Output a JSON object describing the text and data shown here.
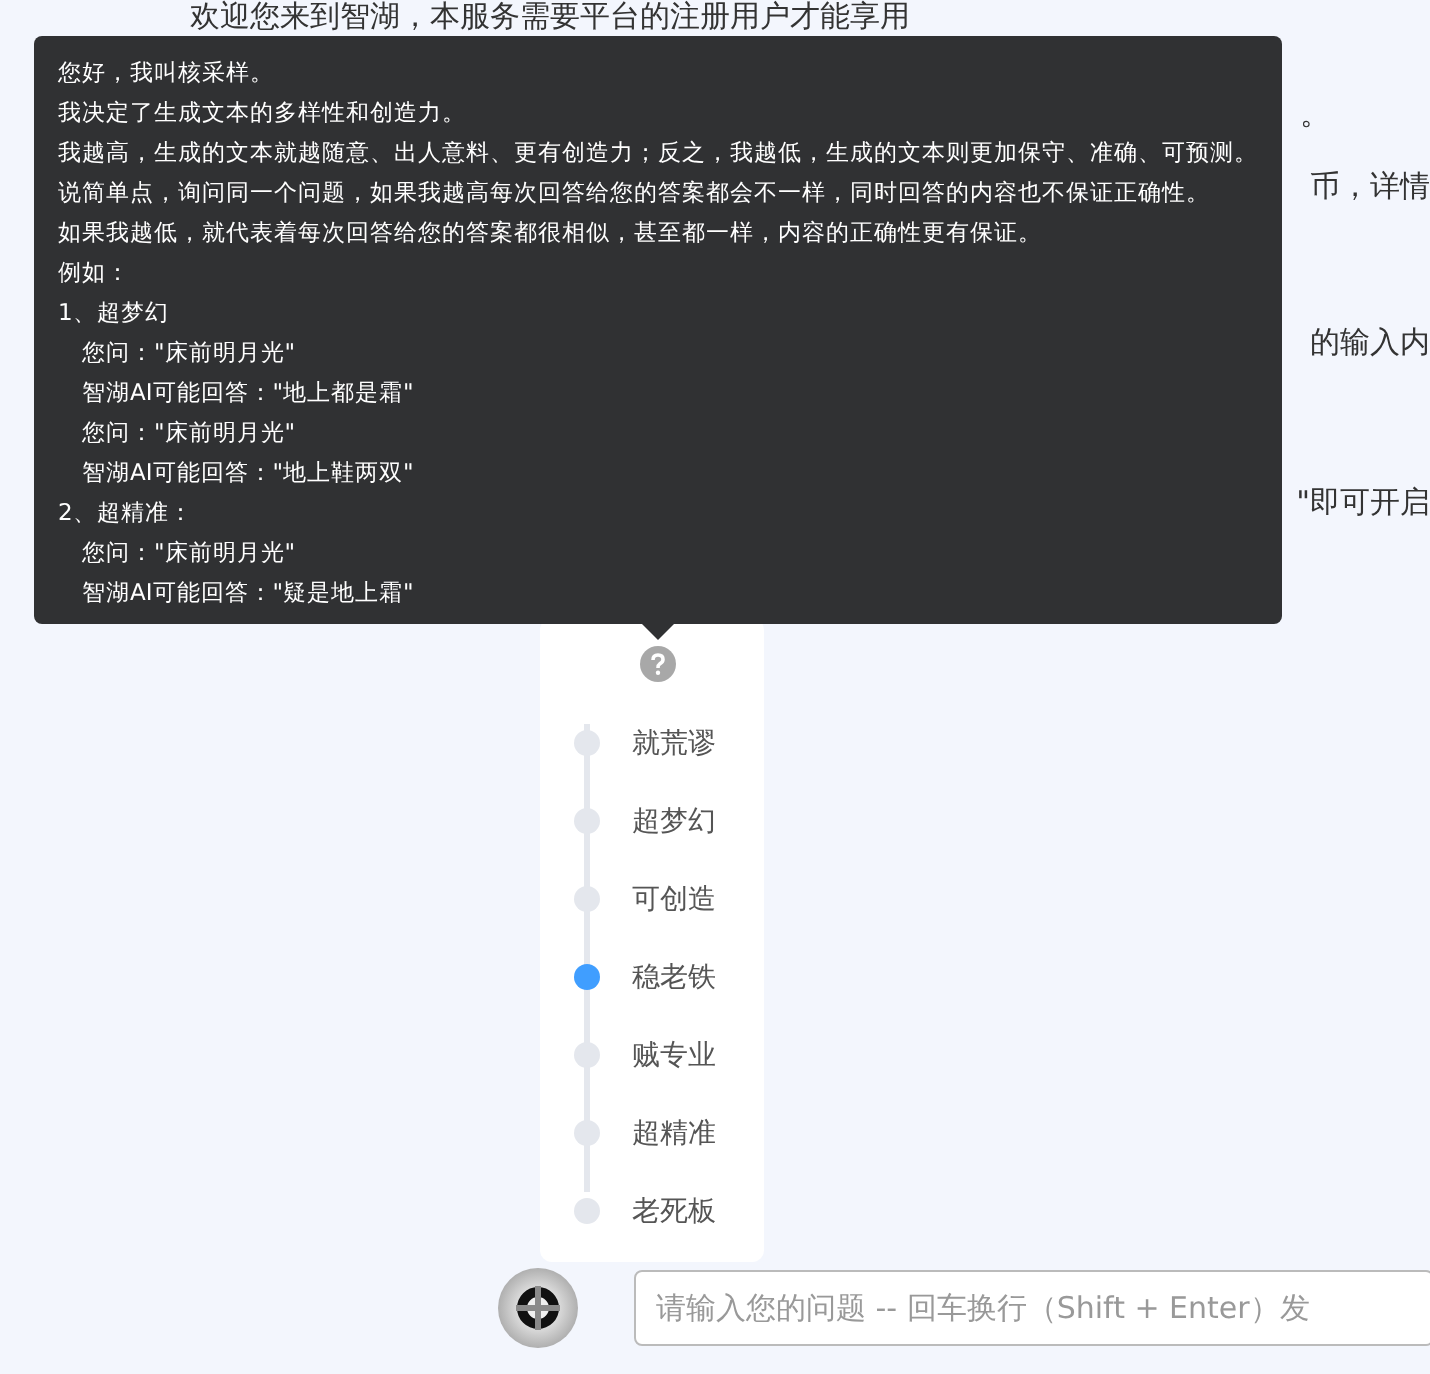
{
  "background_text": {
    "first_line": "欢迎您来到智湖，本服务需要平台的注册用户才能享用",
    "fragments": [
      "。",
      "币，详情",
      "的输入内",
      "\"即可开启"
    ]
  },
  "tooltip": {
    "paragraphs": [
      "您好，我叫核采样。",
      "我决定了生成文本的多样性和创造力。",
      "我越高，生成的文本就越随意、出人意料、更有创造力；反之，我越低，生成的文本则更加保守、准确、可预测。",
      "说简单点，询问同一个问题，如果我越高每次回答给您的答案都会不一样，同时回答的内容也不保证正确性。",
      "如果我越低，就代表着每次回答给您的答案都很相似，甚至都一样，内容的正确性更有保证。",
      "例如："
    ],
    "examples": [
      {
        "title": "1、超梦幻",
        "children": [
          "您问：\"床前明月光\"",
          "智湖AI可能回答：\"地上都是霜\"",
          "您问：\"床前明月光\"",
          "智湖AI可能回答：\"地上鞋两双\""
        ]
      },
      {
        "title": "2、超精准：",
        "children": [
          "您问：\"床前明月光\"",
          "智湖AI可能回答：\"疑是地上霜\""
        ]
      }
    ]
  },
  "slider": {
    "items": [
      {
        "label": "就荒谬",
        "selected": false
      },
      {
        "label": "超梦幻",
        "selected": false
      },
      {
        "label": "可创造",
        "selected": false
      },
      {
        "label": "稳老铁",
        "selected": true
      },
      {
        "label": "贼专业",
        "selected": false
      },
      {
        "label": "超精准",
        "selected": false
      },
      {
        "label": "老死板",
        "selected": false
      }
    ]
  },
  "input": {
    "placeholder": "请输入您的问题 -- 回车换行（Shift + Enter）发"
  }
}
